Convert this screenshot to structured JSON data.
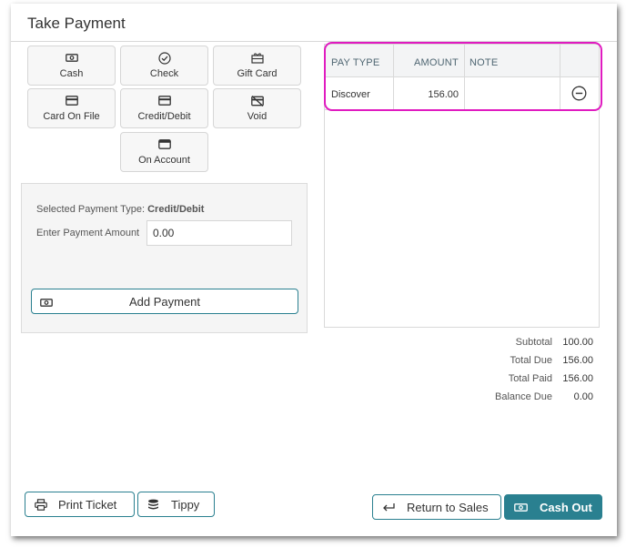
{
  "dialog": {
    "title": "Take Payment"
  },
  "payment_types": [
    {
      "label": "Cash",
      "icon": "cash-icon"
    },
    {
      "label": "Check",
      "icon": "check-circle-icon"
    },
    {
      "label": "Gift Card",
      "icon": "gift-card-icon"
    },
    {
      "label": "Card On File",
      "icon": "credit-card-icon"
    },
    {
      "label": "Credit/Debit",
      "icon": "credit-card-icon"
    },
    {
      "label": "Void",
      "icon": "void-card-icon"
    },
    {
      "label": "On Account",
      "icon": "wallet-icon"
    }
  ],
  "entry": {
    "selected_label": "Selected Payment Type:",
    "selected_value": "Credit/Debit",
    "amount_label": "Enter Payment Amount",
    "amount_value": "0.00",
    "add_button": "Add Payment"
  },
  "payments_table": {
    "columns": [
      "PAY TYPE",
      "AMOUNT",
      "NOTE"
    ],
    "rows": [
      {
        "pay_type": "Discover",
        "amount": "156.00",
        "note": ""
      }
    ]
  },
  "totals": [
    {
      "label": "Subtotal",
      "value": "100.00"
    },
    {
      "label": "Total Due",
      "value": "156.00"
    },
    {
      "label": "Total Paid",
      "value": "156.00"
    },
    {
      "label": "Balance Due",
      "value": "0.00"
    }
  ],
  "footer": {
    "print_ticket": "Print Ticket",
    "tippy": "Tippy",
    "return_to_sales": "Return to Sales",
    "cash_out": "Cash Out"
  },
  "colors": {
    "accent": "#2a8090",
    "highlight": "#e01bc0"
  }
}
